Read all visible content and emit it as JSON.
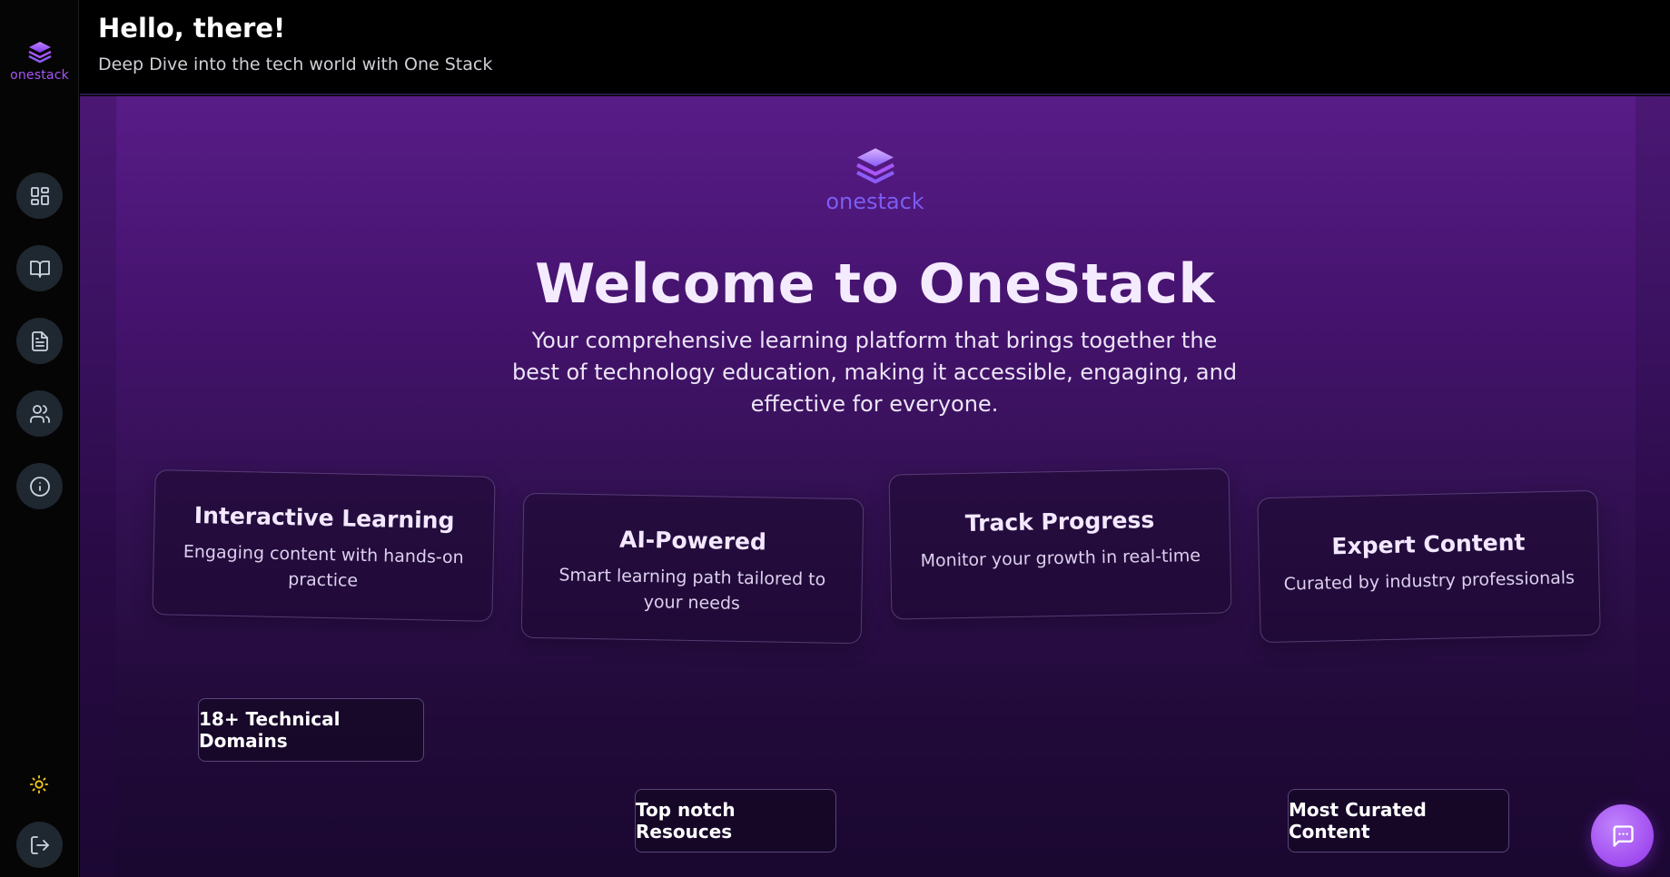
{
  "sidebar": {
    "brand": "onestack",
    "nav": [
      {
        "id": "dashboard",
        "icon": "dashboard-grid-icon"
      },
      {
        "id": "courses",
        "icon": "book-open-icon"
      },
      {
        "id": "notes",
        "icon": "document-icon"
      },
      {
        "id": "community",
        "icon": "users-icon"
      },
      {
        "id": "about",
        "icon": "info-icon"
      }
    ],
    "theme_icon": "sun-icon",
    "logout_icon": "logout-icon"
  },
  "header": {
    "greeting": "Hello, there!",
    "subtitle": "Deep Dive into the tech world with One Stack"
  },
  "hero": {
    "logo_text": "onestack",
    "title": "Welcome to OneStack",
    "description": "Your comprehensive learning platform that brings together the best of technology education, making it accessible, engaging, and effective for everyone."
  },
  "features": [
    {
      "title": "Interactive Learning",
      "desc": "Engaging content with hands-on practice"
    },
    {
      "title": "AI-Powered",
      "desc": "Smart learning path tailored to your needs"
    },
    {
      "title": "Track Progress",
      "desc": "Monitor your growth in real-time"
    },
    {
      "title": "Expert Content",
      "desc": "Curated by industry professionals"
    }
  ],
  "highlights": [
    {
      "label": "18+ Technical Domains"
    },
    {
      "label": "Top notch Resouces"
    },
    {
      "label": "Most Curated Content"
    }
  ],
  "chat": {
    "icon": "chat-bubble-icon"
  },
  "colors": {
    "accent": "#a855f7",
    "background": "#000000",
    "main_gradient_top": "#581c87",
    "main_gradient_bottom": "#1a0830",
    "sidebar_button": "#1f2730",
    "sun": "#facc15"
  }
}
